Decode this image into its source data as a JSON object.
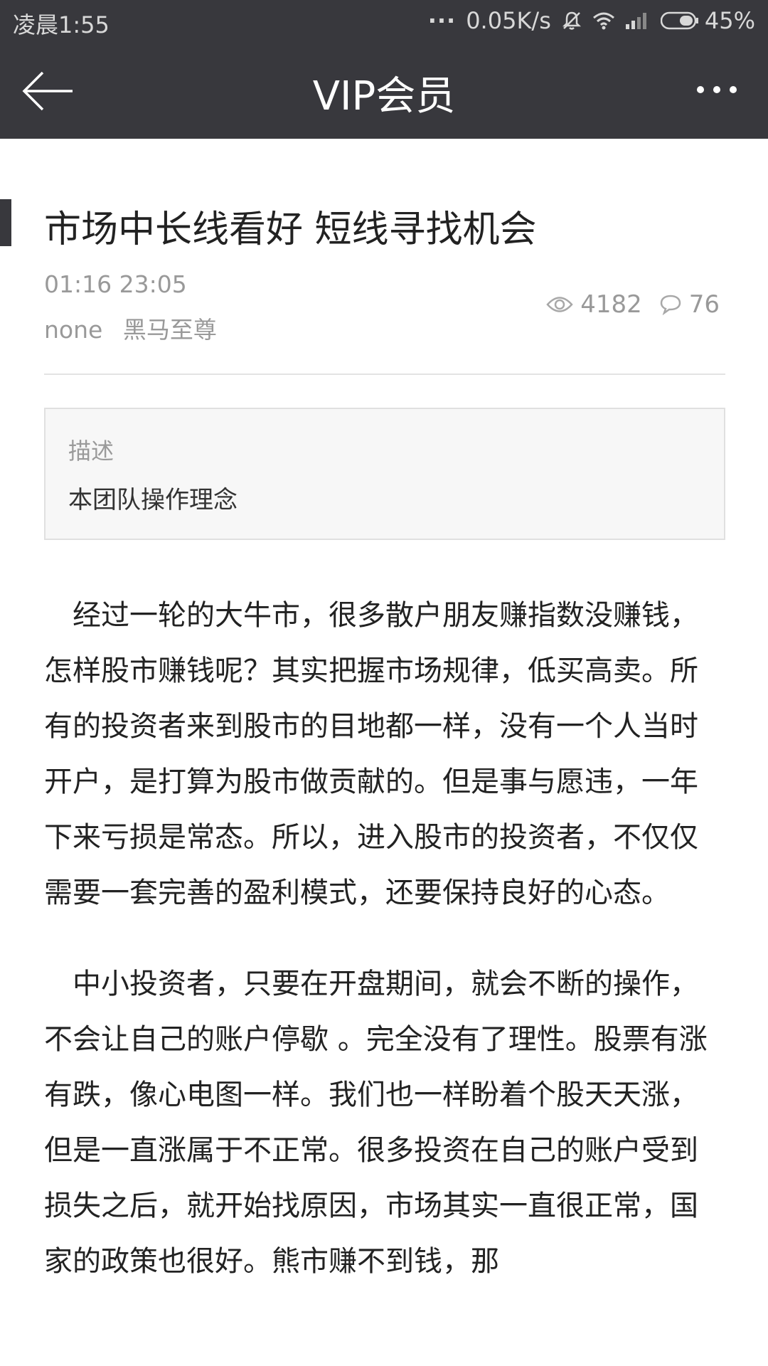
{
  "status_bar": {
    "time": "凌晨1:55",
    "net_speed": "0.05K/s",
    "battery": "45%"
  },
  "app_bar": {
    "title": "VIP会员",
    "back_icon": "back-arrow-icon",
    "more_icon": "more-dots-icon"
  },
  "article": {
    "title": "市场中长线看好 短线寻找机会",
    "date": "01:16 23:05",
    "source": "none",
    "author": "黑马至尊",
    "views": "4182",
    "comments": "76"
  },
  "description": {
    "label": "描述",
    "text": "本团队操作理念"
  },
  "paragraphs": [
    "经过一轮的大牛市，很多散户朋友赚指数没赚钱，怎样股市赚钱呢？其实把握市场规律，低买高卖。所有的投资者来到股市的目地都一样，没有一个人当时开户，是打算为股市做贡献的。但是事与愿违，一年下来亏损是常态。所以，进入股市的投资者，不仅仅需要一套完善的盈利模式，还要保持良好的心态。",
    "中小投资者，只要在开盘期间，就会不断的操作，不会让自己的账户停歇 。完全没有了理性。股票有涨有跌，像心电图一样。我们也一样盼着个股天天涨，但是一直涨属于不正常。很多投资在自己的账户受到损失之后，就开始找原因，市场其实一直很正常，国家的政策也很好。熊市赚不到钱，那"
  ],
  "colors": {
    "header_bg": "#38383d",
    "meta_gray": "#999999",
    "text": "#222222"
  }
}
